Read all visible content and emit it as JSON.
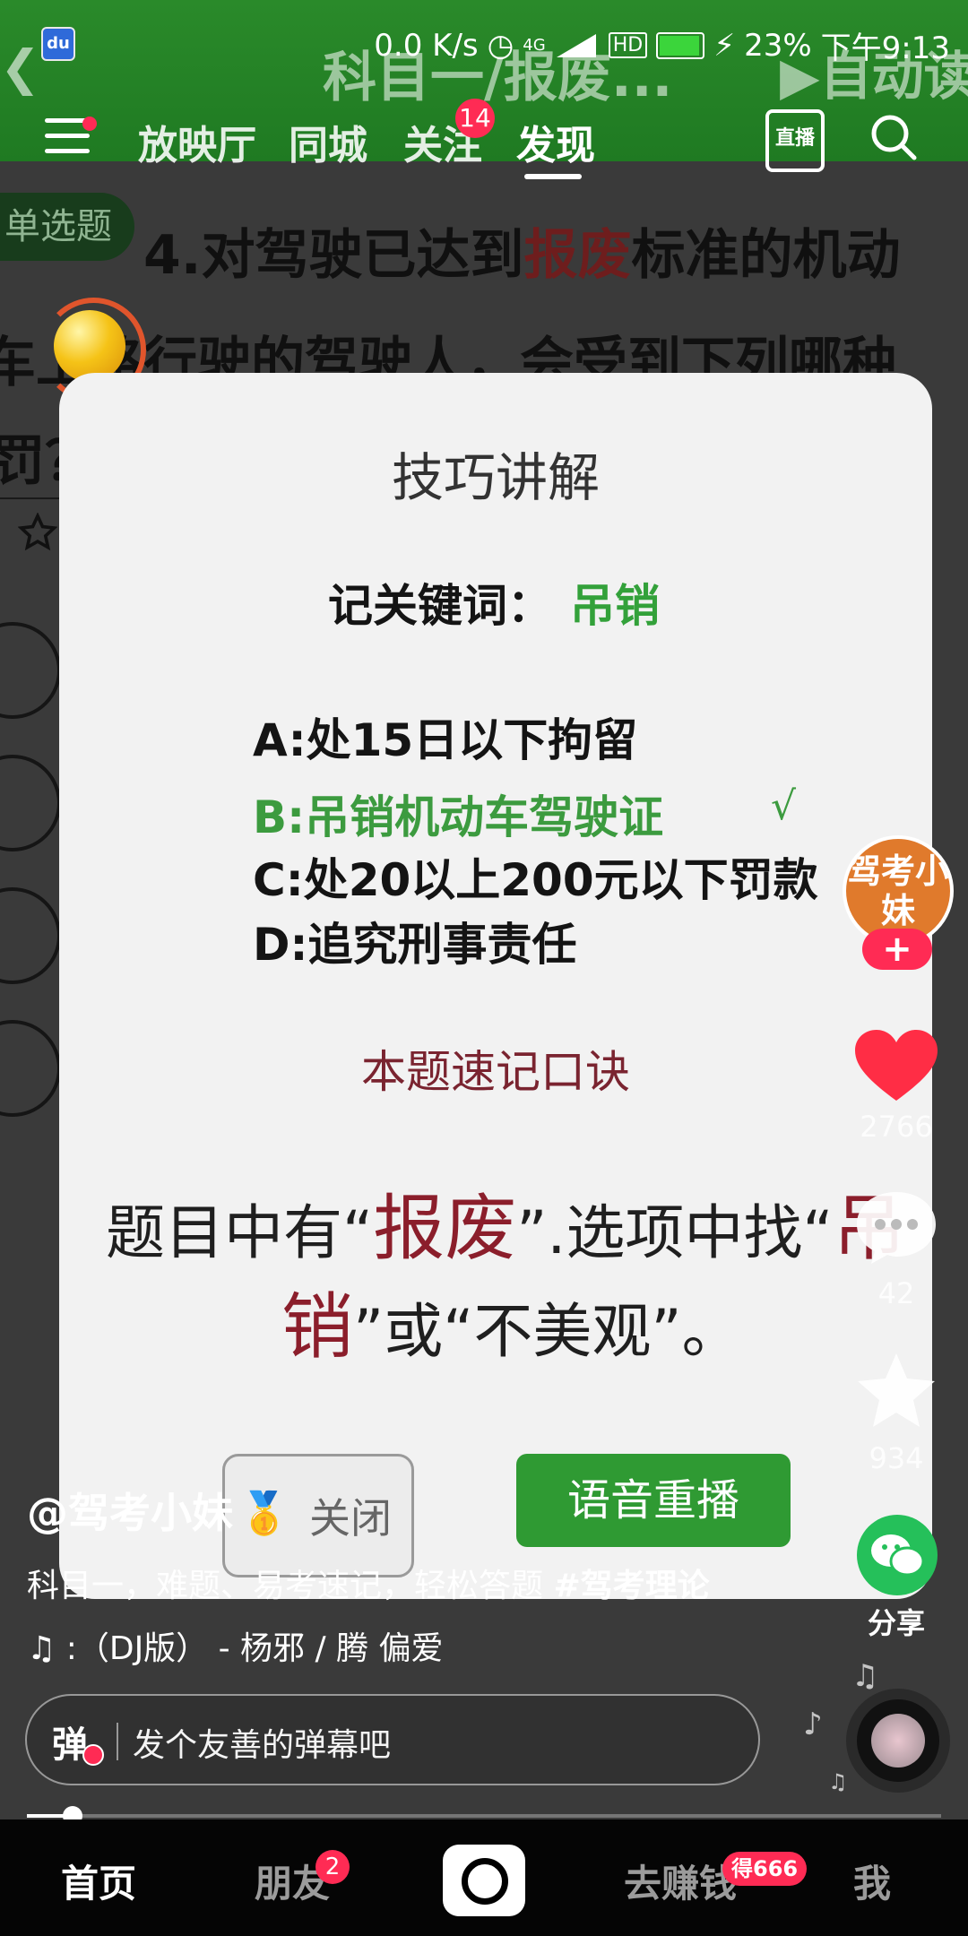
{
  "status_bar": {
    "net_speed": "0.0 K/s",
    "signal_label": "4G",
    "hd_label": "HD",
    "battery": "23%",
    "time": "下午9:13"
  },
  "video_bg": {
    "title": "科目一/报废...",
    "autoread": "▶自动读",
    "badge": "单选题",
    "question_num": "4.",
    "question_line1_pre": "对驾驶已达到",
    "question_line1_red": "报废",
    "question_line1_post": "标准的机动",
    "question_line2": "车上路行驶的驾驶人，会受到下列哪种",
    "question_line3": "罚？"
  },
  "top_nav": {
    "tabs": [
      "放映厅",
      "同城",
      "关注",
      "发现"
    ],
    "follow_badge": "14",
    "live_label": "直播"
  },
  "popup": {
    "title": "技巧讲解",
    "keyword_label": "记关键词：",
    "keyword": "吊销",
    "options": [
      "A:处15日以下拘留",
      "B:吊销机动车驾驶证",
      "C:处20以上200元以下罚款",
      "D:追究刑事责任"
    ],
    "check": "√",
    "tip_head": "本题速记口诀",
    "tip_l1_a": "题目中有“",
    "tip_l1_red": "报废",
    "tip_l1_b": "”.选项中找“",
    "tip_l1_red2": "吊",
    "tip_l2_red": "销",
    "tip_l2_b": "”或“不美观”。",
    "close_label": "关闭",
    "replay_label": "语音重播"
  },
  "side": {
    "avatar_text": "驾考小妹",
    "follow": "+",
    "likes": "2766",
    "comments": "42",
    "favorites": "934",
    "share": "分享"
  },
  "caption": {
    "author": "@驾考小妹",
    "text": "科目一，难题、易考速记，轻松答题 ",
    "hashtag": "#驾考理论",
    "music": "♫ :（DJ版） - 杨邪 / 腾    偏爱",
    "danmaku_icon": "弹",
    "danmaku_placeholder": "发个友善的弹幕吧"
  },
  "progress": {
    "fraction": 0.05
  },
  "bottom_nav": {
    "home": "首页",
    "friends": "朋友",
    "friends_badge": "2",
    "earn": "去赚钱",
    "earn_badge": "得666",
    "me": "我"
  },
  "colors": {
    "accent_red": "#ff2b54",
    "keyword_green": "#33a13a",
    "replay_green": "#2f9a33",
    "share_green": "#25c05a"
  }
}
